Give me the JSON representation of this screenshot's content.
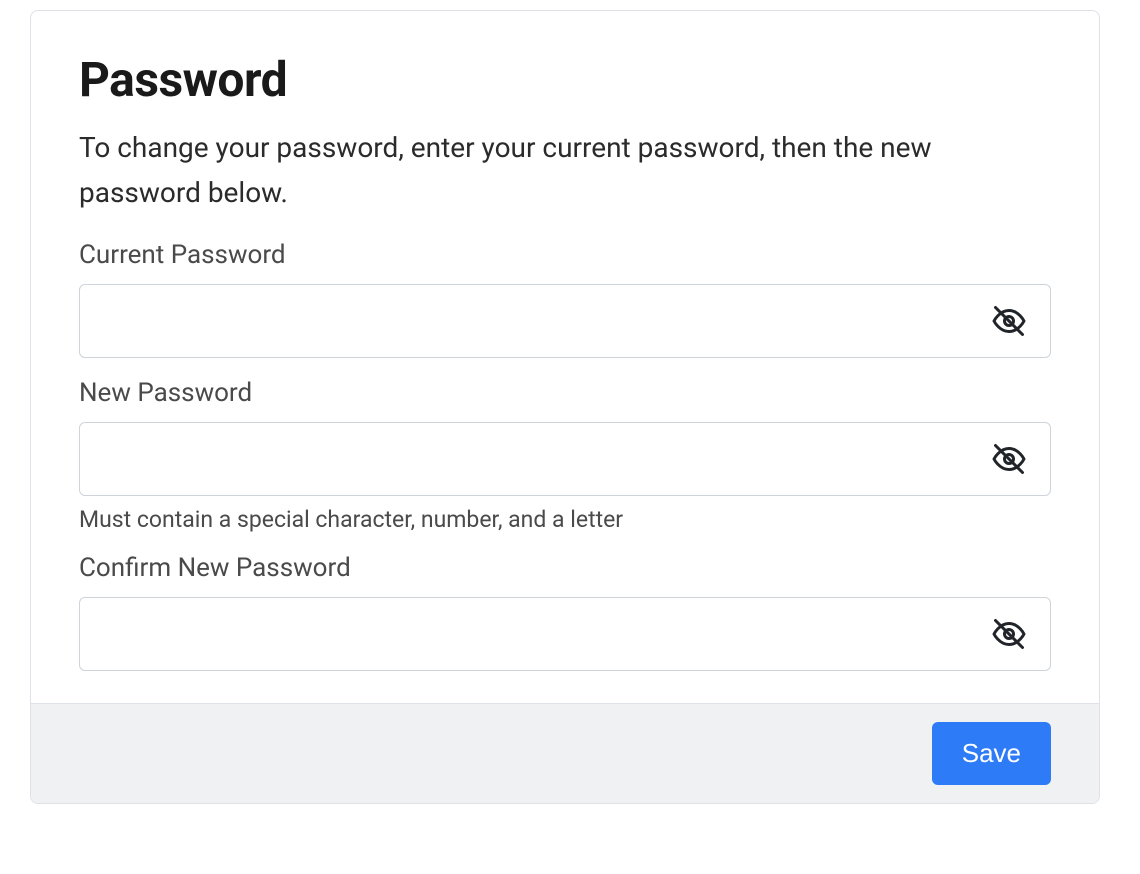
{
  "card": {
    "title": "Password",
    "description": "To change your password, enter your current password, then the new password below."
  },
  "fields": {
    "current": {
      "label": "Current Password",
      "value": ""
    },
    "new": {
      "label": "New Password",
      "value": "",
      "help": "Must contain a special character, number, and a letter"
    },
    "confirm": {
      "label": "Confirm New Password",
      "value": ""
    }
  },
  "footer": {
    "save_label": "Save"
  }
}
